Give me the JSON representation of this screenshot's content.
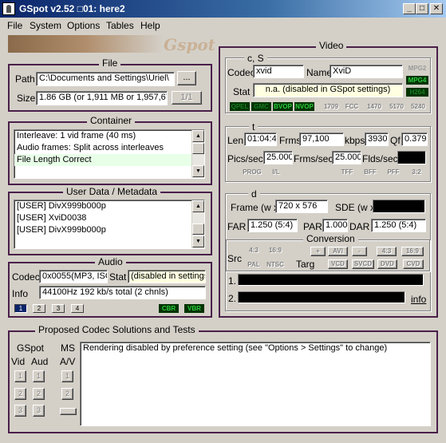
{
  "window": {
    "title": "GSpot v2.52 □01: here2",
    "controls": {
      "minimize": "_",
      "maximize": "□",
      "close": "✕"
    }
  },
  "menu": [
    "File",
    "System",
    "Options",
    "Tables",
    "Help"
  ],
  "logo_text": "Gspot",
  "file": {
    "title": "File",
    "path_label": "Path",
    "path_value": "C:\\Documents and Settings\\Uriel\\",
    "browse_label": "...",
    "size_label": "Size",
    "size_value": "1.86 GB (or 1,911 MB or 1,957,67",
    "part_label": "1/1"
  },
  "container": {
    "title": "Container",
    "lines": [
      "Interleave: 1 vid frame (40 ms)",
      "Audio frames: Split across interleaves",
      "File Length Correct"
    ]
  },
  "userdata": {
    "title": "User Data / Metadata",
    "lines": [
      "[USER]    DivX999b000p",
      "[USER]    XviD0038",
      "[USER]    DivX999b000p"
    ]
  },
  "audio": {
    "title": "Audio",
    "codec_label": "Codec",
    "codec_value": "0x0055(MP3, ISO",
    "stat_label": "Stat",
    "stat_value": "(disabled in settings)",
    "info_label": "Info",
    "info_value": "44100Hz  192 kb/s total (2 chnls)",
    "tracks": [
      "1",
      "2",
      "3",
      "4"
    ],
    "cbr": "CBR",
    "vbr": "VBR"
  },
  "video": {
    "title": "Video",
    "cs": {
      "title": "c, S",
      "codec_label": "Codec",
      "codec_value": "xvid",
      "name_label": "Name",
      "name_value": "XviD",
      "stat_label": "Stat",
      "stat_value": "n.a. (disabled in GSpot settings)",
      "badges": {
        "mpg2": "MPG2",
        "mpg4": "MPG4",
        "h264": "H264"
      },
      "flags": [
        "QPEL",
        "GMC",
        "BVOP",
        "NVOP",
        "1709",
        "FCC",
        "1470",
        "5170",
        "5240"
      ]
    },
    "t": {
      "title": "t",
      "len_label": "Len",
      "len_value": "01:04:44",
      "frms_label": "Frms",
      "frms_value": "97,100",
      "kbps_label": "kbps",
      "kbps_value": "3930",
      "qf_label": "Qf",
      "qf_value": "0.379",
      "pics_label": "Pics/sec",
      "pics_value": "25.000",
      "frms_sec_label": "Frms/sec",
      "frms_sec_value": "25.000",
      "flds_label": "Flds/sec",
      "flags": [
        "PROG",
        "I/L",
        "TFF",
        "BFF",
        "PFF",
        "3:2"
      ]
    },
    "d": {
      "title": "d",
      "frame_label": "Frame (w x",
      "frame_value": "720 x 576",
      "sde_label": "SDE (w x",
      "far_label": "FAR",
      "far_value": "1.250 (5:4)",
      "par_label": "PAR",
      "par_value": "1.000",
      "dar_label": "DAR",
      "dar_value": "1.250 (5:4)",
      "conversion_title": "Conversion",
      "src_label": "Src",
      "targ_label": "Targ",
      "src_flags": [
        "4:3",
        "16:9",
        "PAL",
        "NTSC"
      ],
      "targ_buttons": [
        "+",
        "AVI",
        "-",
        "4:3",
        "16:9",
        "VCD",
        "SVCD",
        "DVD",
        "CVD"
      ],
      "line1_label": "1.",
      "line2_label": "2.",
      "info_link": "info"
    }
  },
  "proposed": {
    "title": "Proposed Codec Solutions and Tests",
    "gspot_label": "GSpot",
    "ms_label": "MS",
    "vid_label": "Vid",
    "aud_label": "Aud",
    "av_label": "A/V",
    "buttons": [
      "1",
      "2",
      "3"
    ],
    "message": "Rendering disabled by preference setting (see \"Options > Settings\" to change)"
  }
}
